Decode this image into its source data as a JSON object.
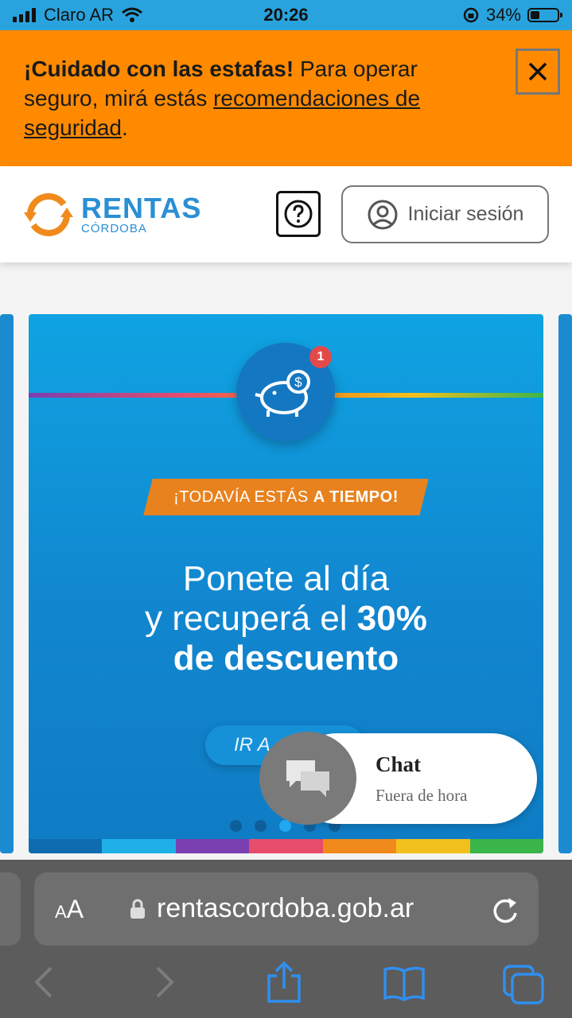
{
  "status_bar": {
    "carrier": "Claro AR",
    "time": "20:26",
    "battery": "34%",
    "battery_level": 0.34
  },
  "warning": {
    "title": "¡Cuidado con las estafas!",
    "text": " Para operar seguro, mirá estás ",
    "link": "recomendaciones de seguridad",
    "end": "."
  },
  "header": {
    "logo_main": "RENTAS",
    "logo_sub": "CÓRDOBA",
    "login_label": "Iniciar sesión"
  },
  "banner": {
    "badge": "1",
    "tag_prefix": "¡TODAVÍA ESTÁS",
    "tag_bold": "A TIEMPO!",
    "line1": "Ponete al día",
    "line2_prefix": "y recuperá el ",
    "line2_bold": "30%",
    "line3": "de descuento",
    "cta": "IR A",
    "dots_total": 5,
    "dots_active": 3
  },
  "chat": {
    "title": "Chat",
    "status": "Fuera de hora"
  },
  "browser": {
    "aa_small": "A",
    "aa_large": "A",
    "url": "rentascordoba.gob.ar"
  },
  "colors": {
    "status_bar": "#29a3dd",
    "warning_bg": "#ff8a00",
    "brand_blue": "#2a8fd4",
    "brand_orange": "#f08a1c",
    "banner_blue": "#1186cf",
    "tag_orange": "#e8821e",
    "browser_bg": "#5c5c5c",
    "ios_blue": "#2f8ff0"
  },
  "icons": {
    "close": "close-icon",
    "help": "question-icon",
    "user": "user-circle-icon",
    "piggy": "piggy-bank-icon",
    "chat": "chat-bubbles-icon",
    "lock": "lock-icon",
    "reload": "reload-icon",
    "back": "chevron-left-icon",
    "forward": "chevron-right-icon",
    "share": "share-icon",
    "bookmarks": "book-icon",
    "tabs": "tabs-icon"
  }
}
